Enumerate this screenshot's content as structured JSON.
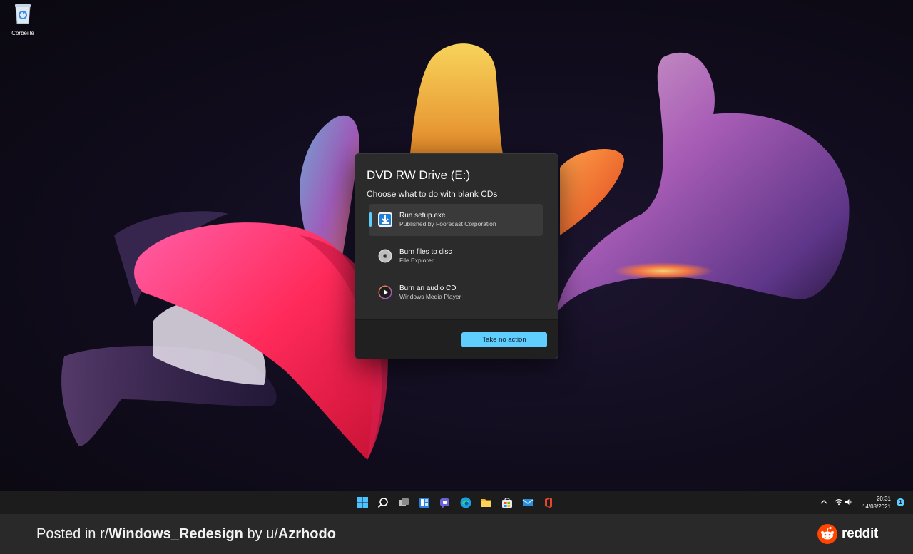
{
  "desktop": {
    "recycle_bin_label": "Corbeille"
  },
  "dialog": {
    "title": "DVD RW Drive (E:)",
    "subtitle": "Choose what to do with blank CDs",
    "options": [
      {
        "title": "Run setup.exe",
        "subtitle": "Published by Foorecast Corporation",
        "icon": "install-download-icon",
        "selected": true
      },
      {
        "title": "Burn files to disc",
        "subtitle": "File Explorer",
        "icon": "disc-icon",
        "selected": false
      },
      {
        "title": "Burn an audio CD",
        "subtitle": "Windows Media Player",
        "icon": "media-player-icon",
        "selected": false
      }
    ],
    "take_no_action_label": "Take no action"
  },
  "taskbar": {
    "apps": [
      "start-icon",
      "search-icon",
      "task-view-icon",
      "widgets-icon",
      "teams-chat-icon",
      "edge-icon",
      "file-explorer-icon",
      "store-icon",
      "mail-icon",
      "office-icon"
    ],
    "time": "20:31",
    "date": "14/08/2021",
    "notification_count": "1"
  },
  "footer": {
    "posted_in": "Posted in r/",
    "subreddit": "Windows_Redesign",
    "by": " by u/",
    "user": "Azrhodo",
    "brand": "reddit"
  },
  "colors": {
    "accent": "#60cdff",
    "dialog_bg": "#2b2b2b",
    "taskbar_bg": "#1c1c1c",
    "footer_bg": "#292929",
    "reddit_orange": "#ff4500"
  }
}
